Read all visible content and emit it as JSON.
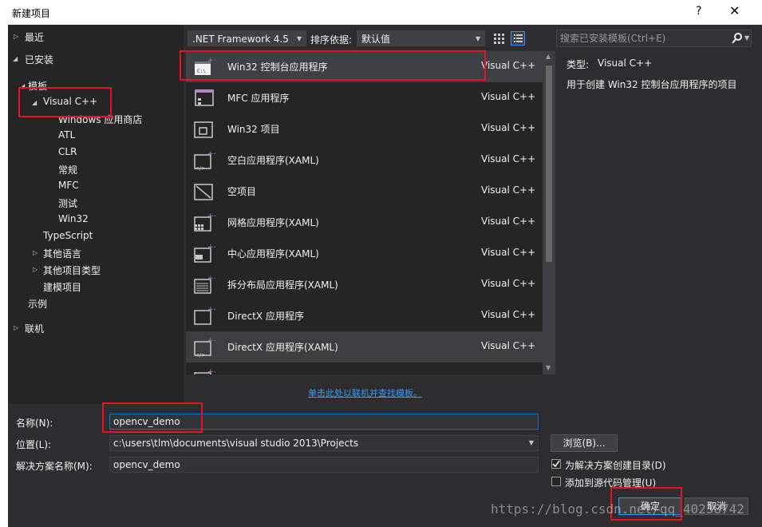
{
  "dialog": {
    "title": "新建项目",
    "help": "?",
    "close": "✕"
  },
  "tree": {
    "recent": "最近",
    "installed": "已安装",
    "templates": "模板",
    "visual_cpp": "Visual C++",
    "children": [
      "Windows 应用商店",
      "ATL",
      "CLR",
      "常规",
      "MFC",
      "测试",
      "Win32"
    ],
    "typescript": "TypeScript",
    "other_languages": "其他语言",
    "other_project_types": "其他项目类型",
    "modeling_projects": "建模项目",
    "samples": "示例",
    "online": "联机"
  },
  "toolbar": {
    "framework": ".NET Framework 4.5",
    "sort_label": "排序依据:",
    "sort_value": "默认值"
  },
  "search": {
    "placeholder": "搜索已安装模板(Ctrl+E)"
  },
  "templates": [
    {
      "name": "Win32 控制台应用程序",
      "lang": "Visual C++",
      "icon": "console-app-icon"
    },
    {
      "name": "MFC 应用程序",
      "lang": "Visual C++",
      "icon": "mfc-app-icon"
    },
    {
      "name": "Win32 项目",
      "lang": "Visual C++",
      "icon": "win32-project-icon"
    },
    {
      "name": "空白应用程序(XAML)",
      "lang": "Visual C++",
      "icon": "blank-app-icon"
    },
    {
      "name": "空项目",
      "lang": "Visual C++",
      "icon": "empty-project-icon"
    },
    {
      "name": "网格应用程序(XAML)",
      "lang": "Visual C++",
      "icon": "grid-app-icon"
    },
    {
      "name": "中心应用程序(XAML)",
      "lang": "Visual C++",
      "icon": "hub-app-icon"
    },
    {
      "name": "拆分布局应用程序(XAML)",
      "lang": "Visual C++",
      "icon": "split-app-icon"
    },
    {
      "name": "DirectX 应用程序",
      "lang": "Visual C++",
      "icon": "directx-app-icon"
    },
    {
      "name": "DirectX 应用程序(XAML)",
      "lang": "Visual C++",
      "icon": "directx-xaml-app-icon"
    }
  ],
  "info": {
    "type_label": "类型:",
    "type_value": "Visual C++",
    "description": "用于创建 Win32 控制台应用程序的项目"
  },
  "online_link": "单击此处以联机并查找模板。",
  "form": {
    "name_label": "名称(N):",
    "name_value": "opencv_demo",
    "location_label": "位置(L):",
    "location_value": "c:\\users\\tlm\\documents\\visual studio 2013\\Projects",
    "solution_label": "解决方案名称(M):",
    "solution_value": "opencv_demo",
    "browse": "浏览(B)...",
    "create_dir": "为解决方案创建目录(D)",
    "add_source_control": "添加到源代码管理(U)",
    "ok": "确定",
    "cancel": "取消"
  },
  "watermark": "https://blog.csdn.net/qq_40238742"
}
